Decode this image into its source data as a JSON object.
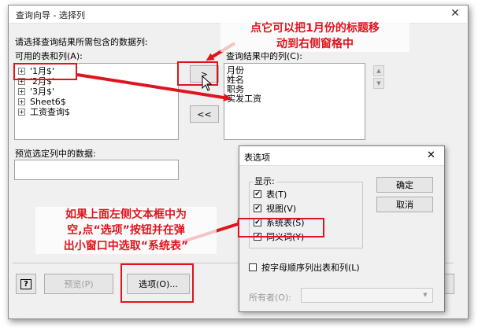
{
  "window": {
    "title": "查询向导 - 选择列",
    "close_glyph": "✕"
  },
  "labels": {
    "instruction": "请选择查询结果所需包含的数据列:",
    "available": "可用的表和列(A):",
    "result_columns": "查询结果中的列(C):",
    "preview": "预览选定列中的数据:"
  },
  "tables": [
    {
      "name": "'1月$'"
    },
    {
      "name": "'2月$'"
    },
    {
      "name": "'3月$'"
    },
    {
      "name": "Sheet6$"
    },
    {
      "name": "工资查询$"
    }
  ],
  "tree_expand_glyph": "+",
  "result_items": [
    "月份",
    "姓名",
    "职务",
    "实发工资"
  ],
  "buttons": {
    "move_right": ">",
    "move_all_left": "<<",
    "help": "?",
    "preview": "预览(P)",
    "options": "选项(O)..."
  },
  "table_options": {
    "title": "表选项",
    "close_glyph": "✕",
    "display_label": "显示:",
    "checkboxes": [
      {
        "label": "表(T)",
        "checked": true
      },
      {
        "label": "视图(V)",
        "checked": true
      },
      {
        "label": "系统表(S)",
        "checked": true
      },
      {
        "label": "同义词(Y)",
        "checked": true
      }
    ],
    "check_glyph": "✔",
    "sort_alpha": {
      "label": "按字母顺序列出表和列(L)",
      "checked": false
    },
    "ok": "确定",
    "cancel": "取消",
    "owner_label": "所有者(O):"
  },
  "annotations": {
    "top": [
      "点它可以把1月份的标题移",
      "动到右侧窗格中"
    ],
    "bottom": [
      "如果上面左侧文本框中为",
      "空,点“选项”按钮并在弹",
      "出小窗口中选取“系统表”"
    ]
  },
  "colors": {
    "annotation_red": "#e0141e"
  }
}
